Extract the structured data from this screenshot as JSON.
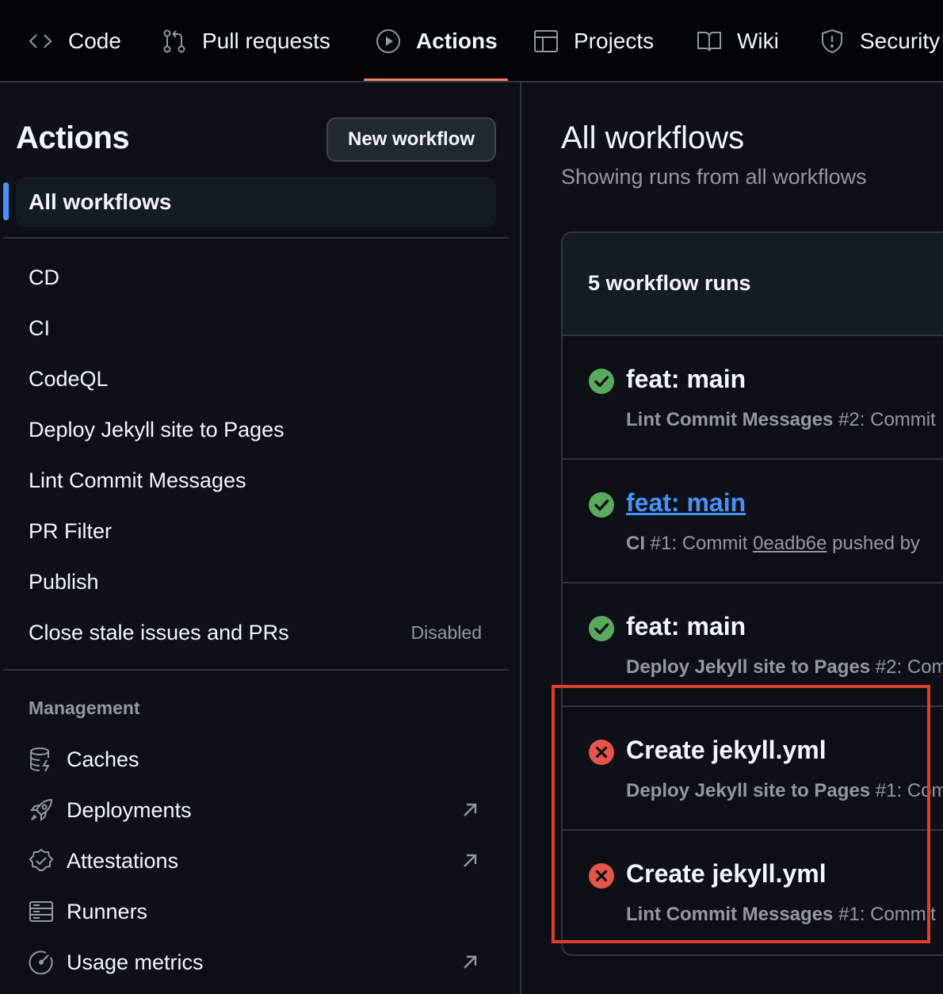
{
  "tabs": [
    {
      "label": "Code",
      "icon": "code-icon"
    },
    {
      "label": "Pull requests",
      "icon": "git-pull-request-icon"
    },
    {
      "label": "Actions",
      "icon": "play-icon",
      "active": true
    },
    {
      "label": "Projects",
      "icon": "table-icon"
    },
    {
      "label": "Wiki",
      "icon": "book-icon"
    },
    {
      "label": "Security",
      "icon": "shield-icon"
    }
  ],
  "sidebar": {
    "title": "Actions",
    "new_workflow_label": "New workflow",
    "all_workflows_label": "All workflows",
    "workflows": [
      {
        "label": "CD"
      },
      {
        "label": "CI"
      },
      {
        "label": "CodeQL"
      },
      {
        "label": "Deploy Jekyll site to Pages"
      },
      {
        "label": "Lint Commit Messages"
      },
      {
        "label": "PR Filter"
      },
      {
        "label": "Publish"
      },
      {
        "label": "Close stale issues and PRs",
        "badge": "Disabled"
      }
    ],
    "management_heading": "Management",
    "management": [
      {
        "label": "Caches",
        "icon": "database-icon"
      },
      {
        "label": "Deployments",
        "icon": "rocket-icon",
        "external": true
      },
      {
        "label": "Attestations",
        "icon": "verified-badge-icon",
        "external": true
      },
      {
        "label": "Runners",
        "icon": "server-icon"
      },
      {
        "label": "Usage metrics",
        "icon": "meter-icon",
        "external": true
      }
    ]
  },
  "main": {
    "title": "All workflows",
    "subtitle": "Showing runs from all workflows",
    "runs_count": "5 workflow runs",
    "runs": [
      {
        "title": "feat: main",
        "status": "success",
        "workflow": "Lint Commit Messages",
        "run_number": "#2:",
        "detail": "Commit"
      },
      {
        "title": "feat: main",
        "status": "success",
        "workflow": "CI",
        "run_number": "#1:",
        "detail": "Commit",
        "commit": "0eadb6e",
        "detail_after": "pushed by",
        "link": true
      },
      {
        "title": "feat: main",
        "status": "success",
        "workflow": "Deploy Jekyll site to Pages",
        "run_number": "#2:",
        "detail": "Commit"
      },
      {
        "title": "Create jekyll.yml",
        "status": "failure",
        "workflow": "Deploy Jekyll site to Pages",
        "run_number": "#1:",
        "detail": "Commit"
      },
      {
        "title": "Create jekyll.yml",
        "status": "failure",
        "workflow": "Lint Commit Messages",
        "run_number": "#1:",
        "detail": "Commit"
      }
    ]
  },
  "colors": {
    "success": "#57ab5a",
    "failure": "#e5534b",
    "accent": "#4493f8",
    "tab_underline": "#f78166",
    "annotation": "#e03e2d"
  }
}
